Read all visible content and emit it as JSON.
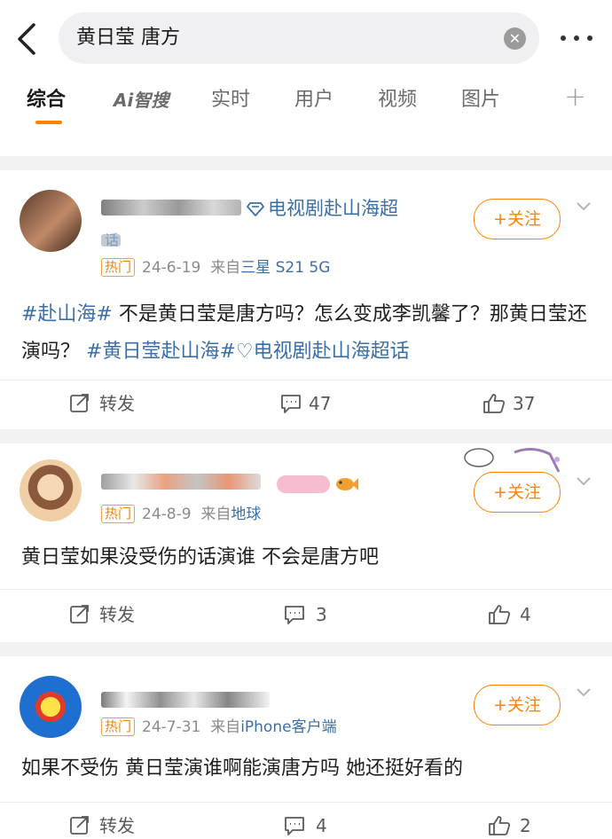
{
  "search": {
    "query": "黄日莹 唐方"
  },
  "icons": {
    "back": "chevron-left-icon",
    "clear": "clear-icon",
    "more": "more-dots-icon"
  },
  "tabs": [
    {
      "label": "综合",
      "active": true
    },
    {
      "label": "智搜",
      "prefix": "Ai"
    },
    {
      "label": "实时"
    },
    {
      "label": "用户"
    },
    {
      "label": "视频"
    },
    {
      "label": "图片"
    },
    {
      "label": "+"
    }
  ],
  "colors": {
    "accent": "#ff8200",
    "link": "#3a6fa8",
    "hot": "#e8841a",
    "muted": "#8b8b8b"
  },
  "posts": [
    {
      "super_topic": "电视剧赴山海超",
      "super_topic_tail": "话",
      "follow_label": "+关注",
      "hot_label": "热门",
      "date": "24-6-19",
      "source_prefix": "来自",
      "device": "三星 S21 5G",
      "text_tag1": "#赴山海#",
      "text_body": " 不是黄日莹是唐方吗？怎么变成李凯馨了？那黄日莹还演吗？",
      "text_tag2": "#黄日莹赴山海#",
      "text_tag3": "电视剧赴山海超话",
      "repost_label": "转发",
      "comments": "47",
      "likes": "37"
    },
    {
      "follow_label": "+关注",
      "hot_label": "热门",
      "date": "24-8-9",
      "source_prefix": "来自",
      "device": "地球",
      "text_body": "黄日莹如果没受伤的话演谁 不会是唐方吧",
      "repost_label": "转发",
      "comments": "3",
      "likes": "4"
    },
    {
      "follow_label": "+关注",
      "hot_label": "热门",
      "date": "24-7-31",
      "source_prefix": "来自",
      "device": "iPhone客户端",
      "text_body": "如果不受伤 黄日莹演谁啊能演唐方吗 她还挺好看的",
      "repost_label": "转发",
      "comments": "4",
      "likes": "2"
    }
  ]
}
